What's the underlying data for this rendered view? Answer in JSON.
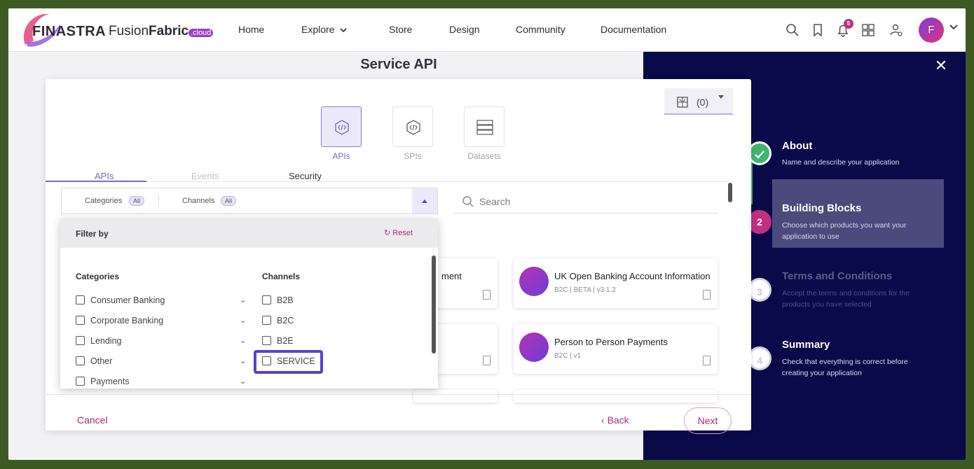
{
  "header": {
    "brand": "FINASTRA",
    "product_prefix": "Fusion",
    "product_bold": "Fabric",
    "product_suffix": ".cloud",
    "nav": [
      "Home",
      "Explore",
      "Store",
      "Design",
      "Community",
      "Documentation"
    ],
    "notification_count": "5",
    "avatar_initial": "F"
  },
  "page": {
    "title": "Service API"
  },
  "modal": {
    "types": [
      {
        "label": "APIs",
        "icon": "api-code-icon",
        "active": true
      },
      {
        "label": "SPIs",
        "icon": "spi-code-icon",
        "active": false
      },
      {
        "label": "Datasets",
        "icon": "dataset-stack-icon",
        "active": false
      }
    ],
    "cart_count": "(0)",
    "tabs": [
      "APIs",
      "Events",
      "Security"
    ],
    "filter_bar": {
      "categories_label": "Categories",
      "categories_value": "All",
      "channels_label": "Channels",
      "channels_value": "All"
    },
    "search_placeholder": "Search",
    "dropdown": {
      "title": "Filter by",
      "reset_label": "Reset",
      "categories_heading": "Categories",
      "channels_heading": "Channels",
      "categories": [
        "Consumer Banking",
        "Corporate Banking",
        "Lending",
        "Other",
        "Payments"
      ],
      "channels": [
        "B2B",
        "B2C",
        "B2E",
        "SERVICE"
      ]
    },
    "cards": [
      {
        "title": "ment",
        "sub": ""
      },
      {
        "title": "UK Open Banking Account Information",
        "sub": "B2C | BETA | v3.1.2"
      },
      {
        "title": "Person to Person Payments",
        "sub": "B2C | v1"
      }
    ],
    "footer": {
      "cancel": "Cancel",
      "back": "Back",
      "next": "Next"
    }
  },
  "wizard": {
    "steps": [
      {
        "number": "",
        "title": "About",
        "desc": "Name and describe your application",
        "state": "done"
      },
      {
        "number": "2",
        "title": "Building Blocks",
        "desc": "Choose which products you want your application to use",
        "state": "active"
      },
      {
        "number": "3",
        "title": "Terms and Conditions",
        "desc": "Accept the terms and conditions for the products you have selected",
        "state": "disabled"
      },
      {
        "number": "4",
        "title": "Summary",
        "desc": "Check that everything is correct before creating your application",
        "state": "pending"
      }
    ]
  },
  "colors": {
    "accent_purple": "#7b66d8",
    "accent_magenta": "#b0287a",
    "panel_navy": "#0a0a4b",
    "step_done_green": "#3fb56e",
    "step_active_magenta": "#c1307f"
  }
}
